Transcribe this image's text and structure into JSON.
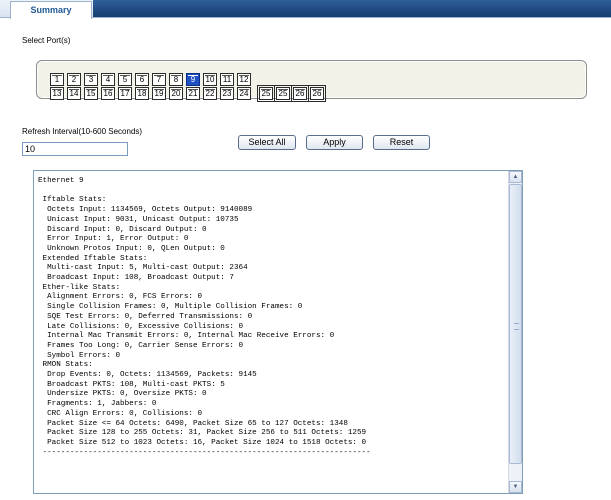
{
  "tabs": {
    "active": "Summary"
  },
  "select_ports_label": "Select Port(s)",
  "ports": {
    "row1": [
      "1",
      "2",
      "3",
      "4",
      "5",
      "6",
      "7",
      "8",
      "9",
      "10",
      "11",
      "12"
    ],
    "row2": [
      "13",
      "14",
      "15",
      "16",
      "17",
      "18",
      "19",
      "20",
      "21",
      "22",
      "23",
      "24"
    ],
    "combo": [
      "25",
      "25",
      "26",
      "26"
    ],
    "selected": "9"
  },
  "refresh": {
    "label": "Refresh Interval(10-600 Seconds)",
    "value": "10"
  },
  "buttons": {
    "select_all": "Select All",
    "apply": "Apply",
    "reset": "Reset"
  },
  "output": {
    "text": "Ethernet 9\n\n Iftable Stats:\n  Octets Input: 1134569, Octets Output: 9140089\n  Unicast Input: 9031, Unicast Output: 10735\n  Discard Input: 0, Discard Output: 0\n  Error Input: 1, Error Output: 0\n  Unknown Protos Input: 0, QLen Output: 0\n Extended Iftable Stats:\n  Multi-cast Input: 5, Multi-cast Output: 2364\n  Broadcast Input: 108, Broadcast Output: 7\n Ether-like Stats:\n  Alignment Errors: 0, FCS Errors: 0\n  Single Collision Frames: 0, Multiple Collision Frames: 0\n  SQE Test Errors: 0, Deferred Transmissions: 0\n  Late Collisions: 0, Excessive Collisions: 0\n  Internal Mac Transmit Errors: 0, Internal Mac Receive Errors: 0\n  Frames Too Long: 0, Carrier Sense Errors: 0\n  Symbol Errors: 0\n RMON Stats:\n  Drop Events: 0, Octets: 1134569, Packets: 9145\n  Broadcast PKTS: 108, Multi-cast PKTS: 5\n  Undersize PKTS: 0, Oversize PKTS: 0\n  Fragments: 1, Jabbers: 0\n  CRC Align Errors: 0, Collisions: 0\n  Packet Size <= 64 Octets: 6490, Packet Size 65 to 127 Octets: 1348\n  Packet Size 128 to 255 Octets: 31, Packet Size 256 to 511 Octets: 1259\n  Packet Size 512 to 1023 Octets: 16, Packet Size 1024 to 1518 Octets: 0\n ------------------------------------------------------------------------"
  },
  "colors": {
    "header_blue": "#163e70",
    "selected_port": "#1e4fc3"
  }
}
